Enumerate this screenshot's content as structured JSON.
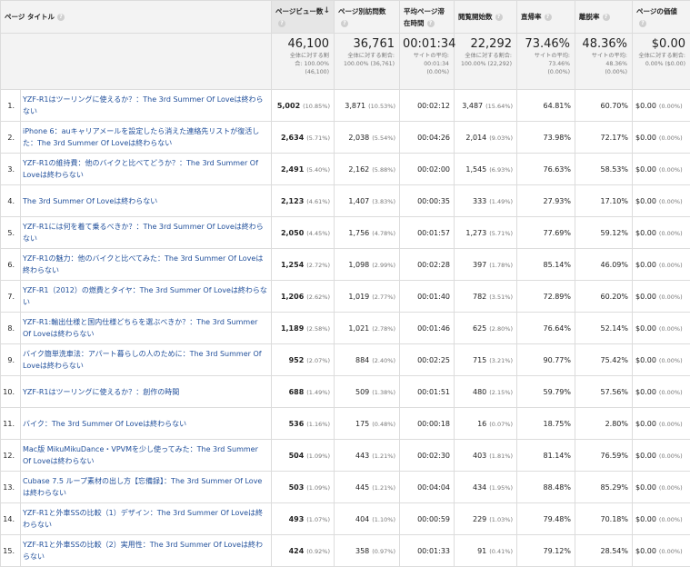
{
  "headers": {
    "page_title": "ページ タイトル",
    "pageviews": "ページビュー数",
    "unique": "ページ別訪問数",
    "avg_time": "平均ページ滞在時間",
    "entrances": "閲覧開始数",
    "bounce": "直帰率",
    "exit": "離脱率",
    "value": "ページの価値"
  },
  "totals": {
    "pageviews": {
      "big": "46,100",
      "sub1": "全体に対する割",
      "sub2": "合: 100.00%",
      "sub3": "(46,100)"
    },
    "unique": {
      "big": "36,761",
      "sub1": "全体に対する割合:",
      "sub2": "100.00% (36,761)",
      "sub3": ""
    },
    "avg_time": {
      "big": "00:01:34",
      "sub1": "サイトの平均:",
      "sub2": "00:01:34",
      "sub3": "(0.00%)"
    },
    "entrances": {
      "big": "22,292",
      "sub1": "全体に対する割合:",
      "sub2": "100.00% (22,292)",
      "sub3": ""
    },
    "bounce": {
      "big": "73.46%",
      "sub1": "サイトの平均:",
      "sub2": "73.46%",
      "sub3": "(0.00%)"
    },
    "exit": {
      "big": "48.36%",
      "sub1": "サイトの平均:",
      "sub2": "48.36%",
      "sub3": "(0.00%)"
    },
    "value": {
      "big": "$0.00",
      "sub1": "全体に対する割合:",
      "sub2": "0.00% ($0.00)",
      "sub3": ""
    }
  },
  "rows": [
    {
      "idx": "1.",
      "title": "YZF-R1はツーリングに使えるか？：The 3rd Summer Of Loveは終わらない",
      "pv": "5,002",
      "pvp": "(10.85%)",
      "u": "3,871",
      "up": "(10.53%)",
      "t": "00:02:12",
      "e": "3,487",
      "ep": "(15.64%)",
      "b": "64.81%",
      "x": "60.70%",
      "v": "$0.00",
      "vp": "(0.00%)"
    },
    {
      "idx": "2.",
      "title": "iPhone 6：auキャリアメールを設定したら消えた連絡先リストが復活した：The 3rd Summer Of Loveは終わらない",
      "pv": "2,634",
      "pvp": "(5.71%)",
      "u": "2,038",
      "up": "(5.54%)",
      "t": "00:04:26",
      "e": "2,014",
      "ep": "(9.03%)",
      "b": "73.98%",
      "x": "72.17%",
      "v": "$0.00",
      "vp": "(0.00%)"
    },
    {
      "idx": "3.",
      "title": "YZF-R1の維持費：他のバイクと比べてどうか？：The 3rd Summer Of Loveは終わらない",
      "pv": "2,491",
      "pvp": "(5.40%)",
      "u": "2,162",
      "up": "(5.88%)",
      "t": "00:02:00",
      "e": "1,545",
      "ep": "(6.93%)",
      "b": "76.63%",
      "x": "58.53%",
      "v": "$0.00",
      "vp": "(0.00%)"
    },
    {
      "idx": "4.",
      "title": "The 3rd Summer Of Loveは終わらない",
      "pv": "2,123",
      "pvp": "(4.61%)",
      "u": "1,407",
      "up": "(3.83%)",
      "t": "00:00:35",
      "e": "333",
      "ep": "(1.49%)",
      "b": "27.93%",
      "x": "17.10%",
      "v": "$0.00",
      "vp": "(0.00%)"
    },
    {
      "idx": "5.",
      "title": "YZF-R1には何を着て乗るべきか？：The 3rd Summer Of Loveは終わらない",
      "pv": "2,050",
      "pvp": "(4.45%)",
      "u": "1,756",
      "up": "(4.78%)",
      "t": "00:01:57",
      "e": "1,273",
      "ep": "(5.71%)",
      "b": "77.69%",
      "x": "59.12%",
      "v": "$0.00",
      "vp": "(0.00%)"
    },
    {
      "idx": "6.",
      "title": "YZF-R1の魅力：他のバイクと比べてみた：The 3rd Summer Of Loveは終わらない",
      "pv": "1,254",
      "pvp": "(2.72%)",
      "u": "1,098",
      "up": "(2.99%)",
      "t": "00:02:28",
      "e": "397",
      "ep": "(1.78%)",
      "b": "85.14%",
      "x": "46.09%",
      "v": "$0.00",
      "vp": "(0.00%)"
    },
    {
      "idx": "7.",
      "title": "YZF-R1（2012）の燃費とタイヤ：The 3rd Summer Of Loveは終わらない",
      "pv": "1,206",
      "pvp": "(2.62%)",
      "u": "1,019",
      "up": "(2.77%)",
      "t": "00:01:40",
      "e": "782",
      "ep": "(3.51%)",
      "b": "72.89%",
      "x": "60.20%",
      "v": "$0.00",
      "vp": "(0.00%)"
    },
    {
      "idx": "8.",
      "title": "YZF-R1:輸出仕様と国内仕様どちらを選ぶべきか？：The 3rd Summer Of Loveは終わらない",
      "pv": "1,189",
      "pvp": "(2.58%)",
      "u": "1,021",
      "up": "(2.78%)",
      "t": "00:01:46",
      "e": "625",
      "ep": "(2.80%)",
      "b": "76.64%",
      "x": "52.14%",
      "v": "$0.00",
      "vp": "(0.00%)"
    },
    {
      "idx": "9.",
      "title": "バイク簡単洗車法：アパート暮らしの人のために：The 3rd Summer Of Loveは終わらない",
      "pv": "952",
      "pvp": "(2.07%)",
      "u": "884",
      "up": "(2.40%)",
      "t": "00:02:25",
      "e": "715",
      "ep": "(3.21%)",
      "b": "90.77%",
      "x": "75.42%",
      "v": "$0.00",
      "vp": "(0.00%)"
    },
    {
      "idx": "10.",
      "title": "YZF-R1はツーリングに使えるか？：創作の時間",
      "pv": "688",
      "pvp": "(1.49%)",
      "u": "509",
      "up": "(1.38%)",
      "t": "00:01:51",
      "e": "480",
      "ep": "(2.15%)",
      "b": "59.79%",
      "x": "57.56%",
      "v": "$0.00",
      "vp": "(0.00%)"
    },
    {
      "idx": "11.",
      "title": "バイク：The 3rd Summer Of Loveは終わらない",
      "pv": "536",
      "pvp": "(1.16%)",
      "u": "175",
      "up": "(0.48%)",
      "t": "00:00:18",
      "e": "16",
      "ep": "(0.07%)",
      "b": "18.75%",
      "x": "2.80%",
      "v": "$0.00",
      "vp": "(0.00%)"
    },
    {
      "idx": "12.",
      "title": "Mac版 MikuMikuDance・VPVMを少し使ってみた：The 3rd Summer Of Loveは終わらない",
      "pv": "504",
      "pvp": "(1.09%)",
      "u": "443",
      "up": "(1.21%)",
      "t": "00:02:30",
      "e": "403",
      "ep": "(1.81%)",
      "b": "81.14%",
      "x": "76.59%",
      "v": "$0.00",
      "vp": "(0.00%)"
    },
    {
      "idx": "13.",
      "title": "Cubase 7.5 ループ素材の出し方【忘備録】：The 3rd Summer Of Loveは終わらない",
      "pv": "503",
      "pvp": "(1.09%)",
      "u": "445",
      "up": "(1.21%)",
      "t": "00:04:04",
      "e": "434",
      "ep": "(1.95%)",
      "b": "88.48%",
      "x": "85.29%",
      "v": "$0.00",
      "vp": "(0.00%)"
    },
    {
      "idx": "14.",
      "title": "YZF-R1と外車SSの比較（1）デザイン：The 3rd Summer Of Loveは終わらない",
      "pv": "493",
      "pvp": "(1.07%)",
      "u": "404",
      "up": "(1.10%)",
      "t": "00:00:59",
      "e": "229",
      "ep": "(1.03%)",
      "b": "79.48%",
      "x": "70.18%",
      "v": "$0.00",
      "vp": "(0.00%)"
    },
    {
      "idx": "15.",
      "title": "YZF-R1と外車SSの比較（2）実用性：The 3rd Summer Of Loveは終わらない",
      "pv": "424",
      "pvp": "(0.92%)",
      "u": "358",
      "up": "(0.97%)",
      "t": "00:01:33",
      "e": "91",
      "ep": "(0.41%)",
      "b": "79.12%",
      "x": "28.54%",
      "v": "$0.00",
      "vp": "(0.00%)"
    }
  ]
}
